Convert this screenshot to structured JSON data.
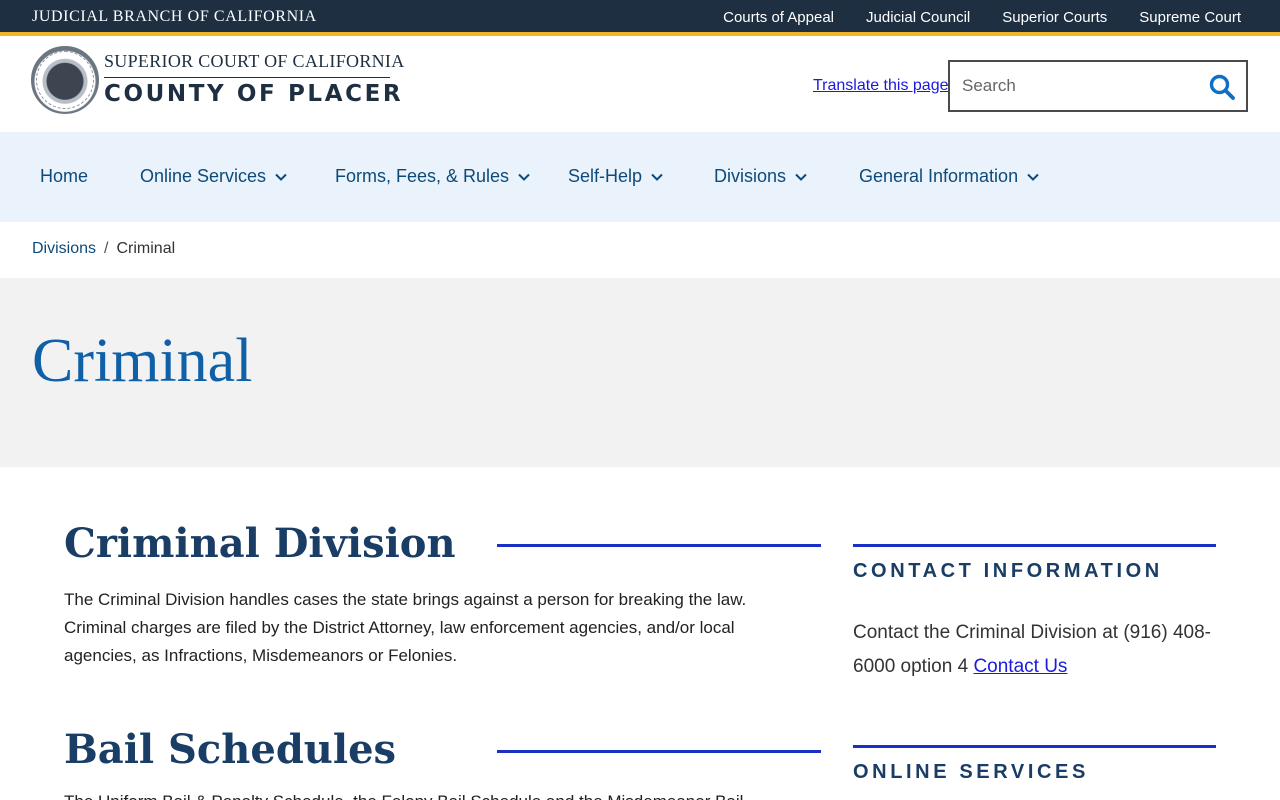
{
  "topbar": {
    "brand": "JUDICIAL BRANCH OF CALIFORNIA",
    "links": [
      "Courts of Appeal",
      "Judicial Council",
      "Superior Courts",
      "Supreme Court"
    ]
  },
  "header": {
    "logo_line1": "SUPERIOR COURT OF CALIFORNIA",
    "logo_line2": "COUNTY OF PLACER",
    "translate": "Translate this page",
    "search_placeholder": "Search"
  },
  "nav": {
    "items": [
      {
        "label": "Home",
        "has_dropdown": false
      },
      {
        "label": "Online Services",
        "has_dropdown": true
      },
      {
        "label": "Forms, Fees, & Rules",
        "has_dropdown": true
      },
      {
        "label": "Self-Help",
        "has_dropdown": true
      },
      {
        "label": "Divisions",
        "has_dropdown": true
      },
      {
        "label": "General Information",
        "has_dropdown": true
      }
    ]
  },
  "breadcrumb": {
    "parent": "Divisions",
    "separator": "/",
    "current": "Criminal"
  },
  "hero": {
    "title": "Criminal"
  },
  "main": {
    "section1": {
      "title": "Criminal Division",
      "body": "The Criminal Division handles cases the state brings against a person for breaking the law. Criminal charges are filed by the District Attorney, law enforcement agencies, and/or local agencies, as Infractions, Misdemeanors or Felonies."
    },
    "section2": {
      "title": "Bail Schedules",
      "body": "The Uniform Bail & Penalty Schedule, the Felony Bail Schedule and the Misdemeanor Bail"
    }
  },
  "sidebar": {
    "contact_title": "CONTACT INFORMATION",
    "contact_text": "Contact the Criminal Division at (916) 408-6000 option 4",
    "contact_link": "Contact Us",
    "online_title": "ONLINE SERVICES"
  },
  "colors": {
    "topbar_bg": "#1e2f41",
    "accent_gold": "#f0b429",
    "nav_bg": "#eaf3fb",
    "hero_bg": "#f2f2f2",
    "heading_blue": "#1060a8",
    "rule_blue": "#1a2fc4",
    "link_blue": "#1a1ae0"
  },
  "icons": {
    "search": "search-icon",
    "dropdown": "chevron-down-icon",
    "seal": "court-seal-icon"
  }
}
